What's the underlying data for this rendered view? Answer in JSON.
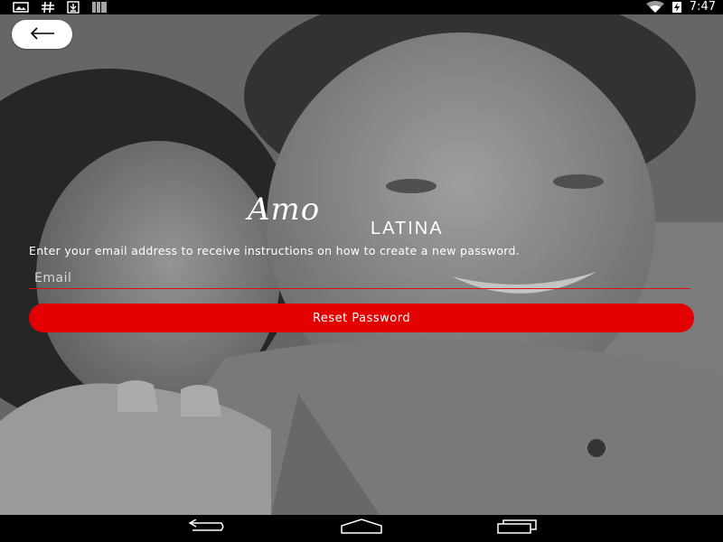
{
  "status_bar": {
    "left_icons": [
      "photo-icon",
      "hash-icon",
      "download-icon",
      "barcode-icon"
    ],
    "right_icons": [
      "wifi-icon",
      "battery-charging-icon"
    ],
    "time": "7:47"
  },
  "back_button": {
    "icon": "arrow-left-icon"
  },
  "logo": {
    "script_text": "Amo",
    "word_text": "LATINA"
  },
  "form": {
    "instructions": "Enter your email address to receive instructions on how to create a new password.",
    "email_placeholder": "Email",
    "email_value": "",
    "reset_button_label": "Reset Password"
  },
  "nav_bar": {
    "icons": [
      "back-icon",
      "home-icon",
      "recents-icon"
    ]
  },
  "colors": {
    "accent": "#e30000",
    "underline": "#e01010",
    "text": "#ffffff",
    "bars": "#000000"
  }
}
